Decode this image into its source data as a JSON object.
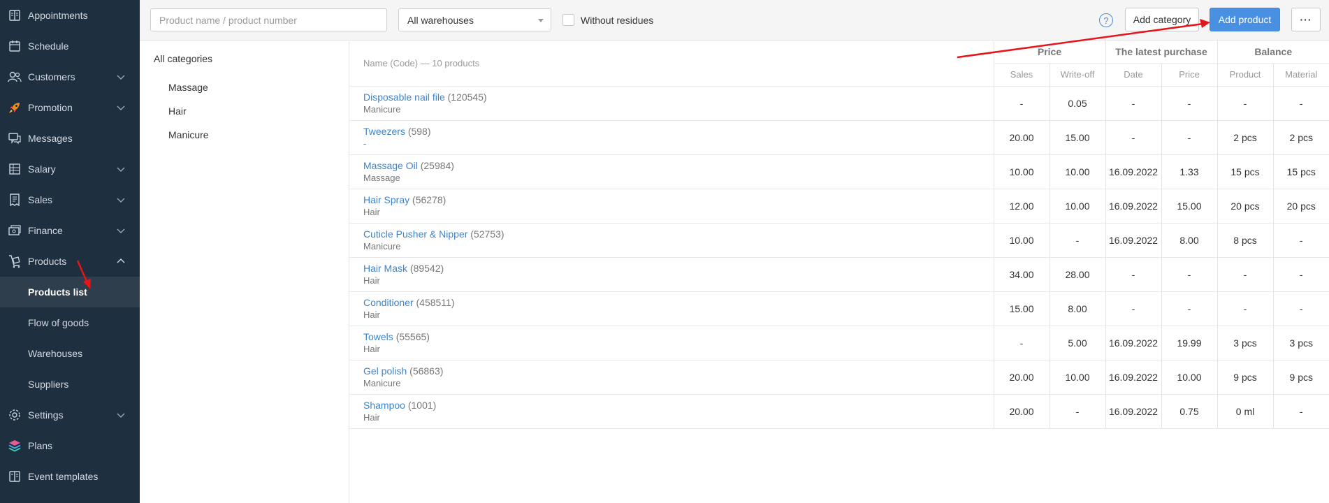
{
  "sidebar": {
    "items": [
      {
        "label": "Appointments",
        "icon": "book-icon",
        "chevron": false
      },
      {
        "label": "Schedule",
        "icon": "calendar-icon",
        "chevron": false
      },
      {
        "label": "Customers",
        "icon": "users-icon",
        "chevron": true
      },
      {
        "label": "Promotion",
        "icon": "rocket-icon",
        "chevron": true
      },
      {
        "label": "Messages",
        "icon": "chat-icon",
        "chevron": false
      },
      {
        "label": "Salary",
        "icon": "ledger-icon",
        "chevron": true
      },
      {
        "label": "Sales",
        "icon": "receipt-icon",
        "chevron": true
      },
      {
        "label": "Finance",
        "icon": "money-icon",
        "chevron": true
      },
      {
        "label": "Products",
        "icon": "cart-icon",
        "chevron": true,
        "expanded": true
      }
    ],
    "sub_items": [
      "Products list",
      "Flow of goods",
      "Warehouses",
      "Suppliers"
    ],
    "active_sub": "Products list",
    "bottom_items": [
      {
        "label": "Settings",
        "icon": "gear-icon",
        "chevron": true
      },
      {
        "label": "Plans",
        "icon": "layers-icon",
        "chevron": false
      },
      {
        "label": "Event templates",
        "icon": "template-icon",
        "chevron": false
      }
    ]
  },
  "toolbar": {
    "search_placeholder": "Product name / product number",
    "warehouse_selected": "All warehouses",
    "without_residues_label": "Without residues",
    "help_label": "?",
    "add_category_label": "Add category",
    "add_product_label": "Add product",
    "more_label": "···"
  },
  "categories": {
    "all_label": "All categories",
    "items": [
      "Massage",
      "Hair",
      "Manicure"
    ]
  },
  "table": {
    "name_header": "Name (Code) — 10 products",
    "groups": [
      "Price",
      "The latest purchase",
      "Balance"
    ],
    "subheaders": [
      "Sales",
      "Write-off",
      "Date",
      "Price",
      "Product",
      "Material"
    ],
    "rows": [
      {
        "name": "Disposable nail file",
        "code": "(120545)",
        "category": "Manicure",
        "sales": "-",
        "writeoff": "0.05",
        "date": "-",
        "price": "-",
        "product": "-",
        "material": "-"
      },
      {
        "name": "Tweezers",
        "code": "(598)",
        "category": "-",
        "sales": "20.00",
        "writeoff": "15.00",
        "date": "-",
        "price": "-",
        "product": "2 pcs",
        "material": "2 pcs"
      },
      {
        "name": "Massage Oil",
        "code": "(25984)",
        "category": "Massage",
        "sales": "10.00",
        "writeoff": "10.00",
        "date": "16.09.2022",
        "price": "1.33",
        "product": "15 pcs",
        "material": "15 pcs"
      },
      {
        "name": "Hair Spray",
        "code": "(56278)",
        "category": "Hair",
        "sales": "12.00",
        "writeoff": "10.00",
        "date": "16.09.2022",
        "price": "15.00",
        "product": "20 pcs",
        "material": "20 pcs"
      },
      {
        "name": "Cuticle Pusher & Nipper",
        "code": "(52753)",
        "category": "Manicure",
        "sales": "10.00",
        "writeoff": "-",
        "date": "16.09.2022",
        "price": "8.00",
        "product": "8 pcs",
        "material": "-"
      },
      {
        "name": "Hair Mask",
        "code": "(89542)",
        "category": "Hair",
        "sales": "34.00",
        "writeoff": "28.00",
        "date": "-",
        "price": "-",
        "product": "-",
        "material": "-"
      },
      {
        "name": "Conditioner",
        "code": "(458511)",
        "category": "Hair",
        "sales": "15.00",
        "writeoff": "8.00",
        "date": "-",
        "price": "-",
        "product": "-",
        "material": "-"
      },
      {
        "name": "Towels",
        "code": "(55565)",
        "category": "Hair",
        "sales": "-",
        "writeoff": "5.00",
        "date": "16.09.2022",
        "price": "19.99",
        "product": "3 pcs",
        "material": "3 pcs"
      },
      {
        "name": "Gel polish",
        "code": "(56863)",
        "category": "Manicure",
        "sales": "20.00",
        "writeoff": "10.00",
        "date": "16.09.2022",
        "price": "10.00",
        "product": "9 pcs",
        "material": "9 pcs"
      },
      {
        "name": "Shampoo",
        "code": "(1001)",
        "category": "Hair",
        "sales": "20.00",
        "writeoff": "-",
        "date": "16.09.2022",
        "price": "0.75",
        "product": "0 ml",
        "material": "-"
      }
    ]
  },
  "colors": {
    "sidebar_bg": "#1e3040",
    "accent": "#4a90e2",
    "link": "#3d84cc",
    "annotation_arrow": "#e8141c"
  }
}
